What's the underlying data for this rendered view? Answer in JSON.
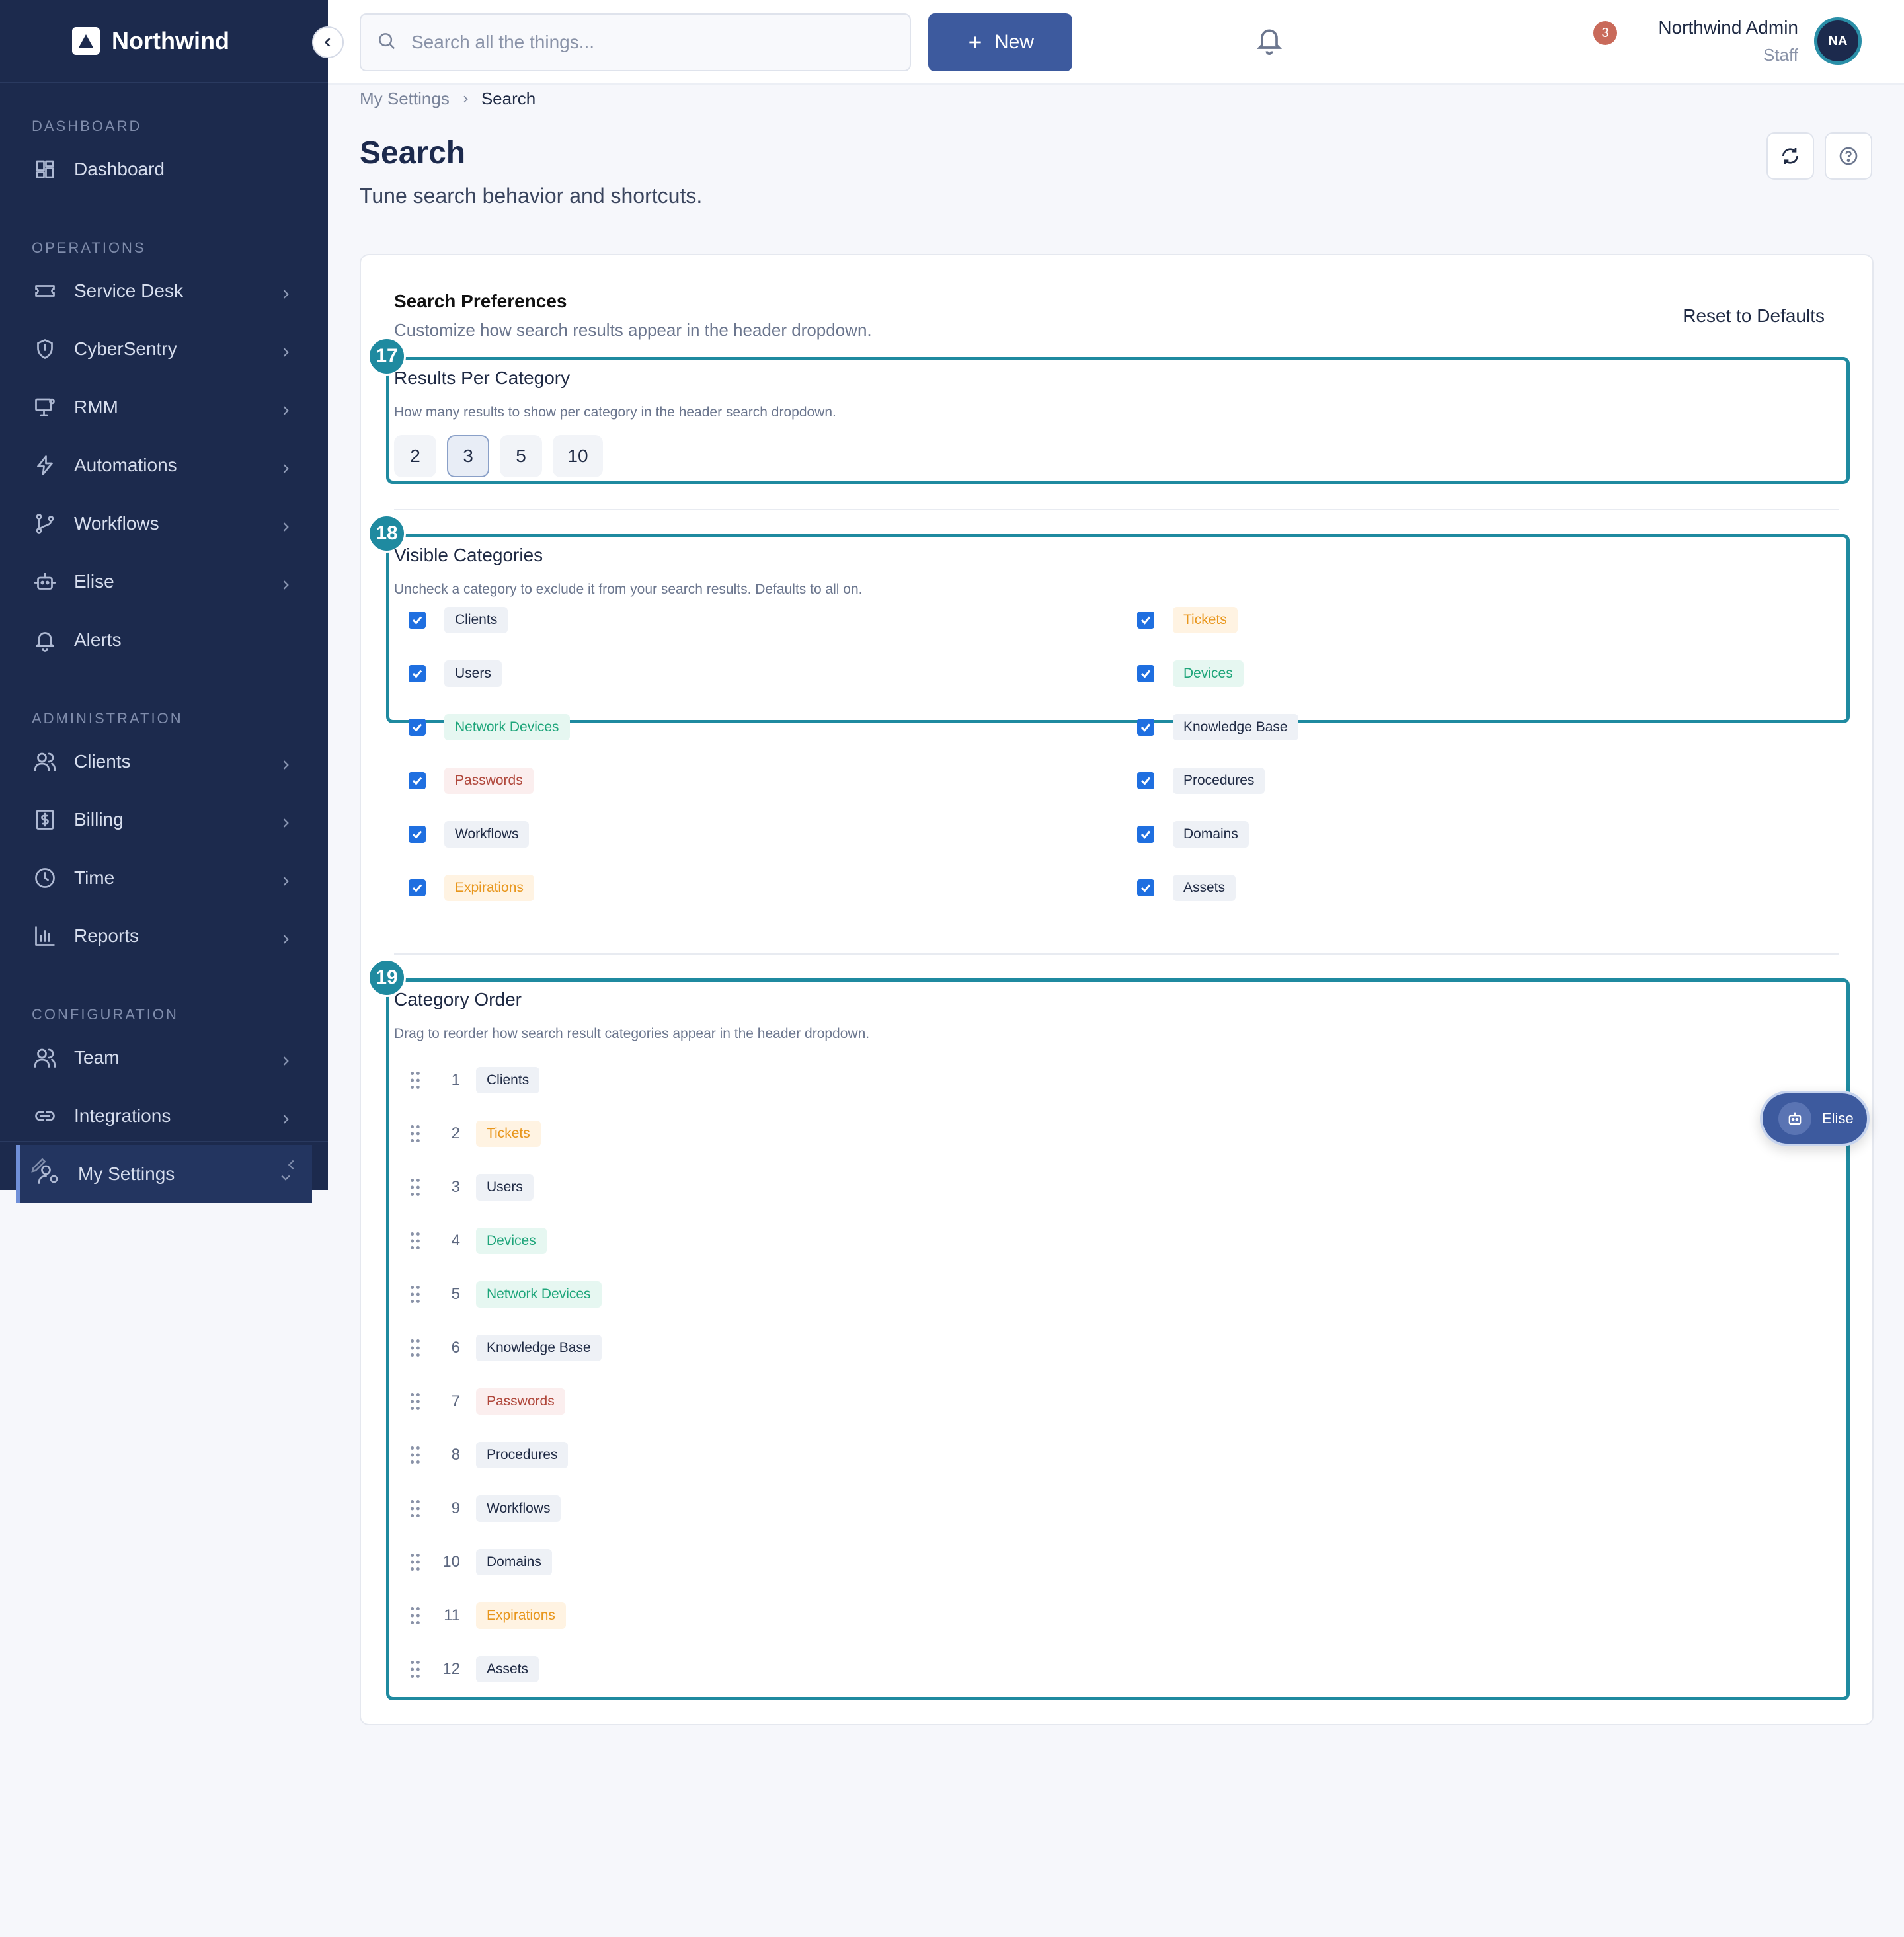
{
  "brand": {
    "name": "Northwind"
  },
  "sidebar": {
    "sections": [
      {
        "title": "DASHBOARD",
        "items": [
          {
            "label": "Dashboard",
            "icon": "dashboard-icon",
            "chevron": false
          }
        ]
      },
      {
        "title": "OPERATIONS",
        "items": [
          {
            "label": "Service Desk",
            "icon": "ticket-icon",
            "chevron": true
          },
          {
            "label": "CyberSentry",
            "icon": "shield-icon",
            "chevron": true
          },
          {
            "label": "RMM",
            "icon": "monitor-icon",
            "chevron": true
          },
          {
            "label": "Automations",
            "icon": "bolt-icon",
            "chevron": true
          },
          {
            "label": "Workflows",
            "icon": "branch-icon",
            "chevron": true
          },
          {
            "label": "Elise",
            "icon": "bot-icon",
            "chevron": true
          },
          {
            "label": "Alerts",
            "icon": "bell-icon",
            "chevron": false
          }
        ]
      },
      {
        "title": "ADMINISTRATION",
        "items": [
          {
            "label": "Clients",
            "icon": "users-icon",
            "chevron": true
          },
          {
            "label": "Billing",
            "icon": "dollar-icon",
            "chevron": true
          },
          {
            "label": "Time",
            "icon": "clock-icon",
            "chevron": true
          },
          {
            "label": "Reports",
            "icon": "bar-chart-icon",
            "chevron": true
          }
        ]
      },
      {
        "title": "CONFIGURATION",
        "items": [
          {
            "label": "Team",
            "icon": "team-icon",
            "chevron": true
          },
          {
            "label": "Integrations",
            "icon": "link-icon",
            "chevron": true
          },
          {
            "label": "My Settings",
            "icon": "user-settings-icon",
            "chevron": true,
            "active": true
          }
        ]
      }
    ]
  },
  "topbar": {
    "search_placeholder": "Search all the things...",
    "new_label": "New",
    "notification_count": "3",
    "user_name": "Northwind Admin",
    "user_role": "Staff",
    "avatar_initials": "NA"
  },
  "breadcrumb": {
    "parent": "My Settings",
    "current": "Search"
  },
  "page": {
    "title": "Search",
    "subtitle": "Tune search behavior and shortcuts."
  },
  "card": {
    "title": "Search Preferences",
    "subtitle": "Customize how search results appear in the header dropdown.",
    "reset_label": "Reset to Defaults"
  },
  "results_per_category": {
    "badge": "17",
    "title": "Results Per Category",
    "description": "How many results to show per category in the header search dropdown.",
    "options": [
      "2",
      "3",
      "5",
      "10"
    ],
    "selected": "3"
  },
  "visible_categories": {
    "badge": "18",
    "title": "Visible Categories",
    "description": "Uncheck a category to exclude it from your search results. Defaults to all on.",
    "left": [
      {
        "label": "Clients",
        "color": "neutral",
        "checked": true
      },
      {
        "label": "Users",
        "color": "neutral",
        "checked": true
      },
      {
        "label": "Network Devices",
        "color": "green",
        "checked": true
      },
      {
        "label": "Passwords",
        "color": "red",
        "checked": true
      },
      {
        "label": "Workflows",
        "color": "neutral",
        "checked": true
      },
      {
        "label": "Expirations",
        "color": "orange",
        "checked": true
      }
    ],
    "right": [
      {
        "label": "Tickets",
        "color": "orange",
        "checked": true
      },
      {
        "label": "Devices",
        "color": "green",
        "checked": true
      },
      {
        "label": "Knowledge Base",
        "color": "neutral",
        "checked": true
      },
      {
        "label": "Procedures",
        "color": "neutral",
        "checked": true
      },
      {
        "label": "Domains",
        "color": "neutral",
        "checked": true
      },
      {
        "label": "Assets",
        "color": "neutral",
        "checked": true
      }
    ]
  },
  "category_order": {
    "badge": "19",
    "title": "Category Order",
    "description": "Drag to reorder how search result categories appear in the header dropdown.",
    "items": [
      {
        "num": "1",
        "label": "Clients",
        "color": "neutral"
      },
      {
        "num": "2",
        "label": "Tickets",
        "color": "orange"
      },
      {
        "num": "3",
        "label": "Users",
        "color": "neutral"
      },
      {
        "num": "4",
        "label": "Devices",
        "color": "green"
      },
      {
        "num": "5",
        "label": "Network Devices",
        "color": "green"
      },
      {
        "num": "6",
        "label": "Knowledge Base",
        "color": "neutral"
      },
      {
        "num": "7",
        "label": "Passwords",
        "color": "red"
      },
      {
        "num": "8",
        "label": "Procedures",
        "color": "neutral"
      },
      {
        "num": "9",
        "label": "Workflows",
        "color": "neutral"
      },
      {
        "num": "10",
        "label": "Domains",
        "color": "neutral"
      },
      {
        "num": "11",
        "label": "Expirations",
        "color": "orange"
      },
      {
        "num": "12",
        "label": "Assets",
        "color": "neutral"
      }
    ]
  },
  "elise_fab": {
    "label": "Elise"
  }
}
